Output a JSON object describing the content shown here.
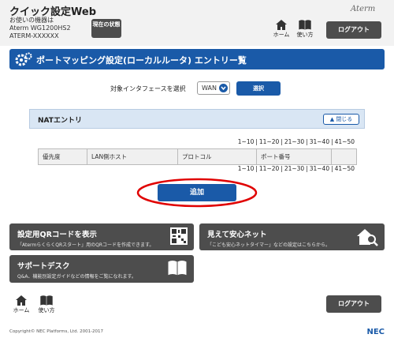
{
  "header": {
    "app_title": "クイック設定Web",
    "device_caption": "お使いの機器は",
    "device_model": "Aterm WG1200HS2",
    "device_id": "ATERM-XXXXXX",
    "status_button": "現在の状態",
    "brand": "Aterm",
    "home_label": "ホーム",
    "manual_label": "使い方",
    "logout_label": "ログアウト"
  },
  "page": {
    "title": "ポートマッピング設定(ローカルルータ) エントリー覧"
  },
  "interface": {
    "label": "対象インタフェースを選択",
    "selected": "WAN",
    "select_button": "選択"
  },
  "nat": {
    "section_label": "NATエントリ",
    "close_button": "閉じる",
    "pager": [
      "1~10",
      "11~20",
      "21~30",
      "31~40",
      "41~50"
    ],
    "columns": [
      "優先度",
      "LAN側ホスト",
      "プロトコル",
      "ポート番号",
      ""
    ],
    "add_button": "追加"
  },
  "tiles": {
    "qr_title": "設定用QRコードを表示",
    "qr_desc": "「AtermらくらくQRスタート」用のQRコードを作成できます。",
    "safety_title": "見えて安心ネット",
    "safety_desc": "「こども安心ネットタイマー」などの設定はこちらから。",
    "support_title": "サポートデスク",
    "support_desc": "Q&A、機能別設定ガイドなどの情報をご覧になれます。"
  },
  "footer": {
    "home_label": "ホーム",
    "manual_label": "使い方",
    "logout_label": "ログアウト",
    "copyright": "Copyright© NEC Platforms, Ltd. 2001-2017",
    "company_logo": "NEC"
  },
  "colors": {
    "primary": "#1a5aa8",
    "dark_tile": "#4d4d4d",
    "highlight": "#e00000"
  }
}
